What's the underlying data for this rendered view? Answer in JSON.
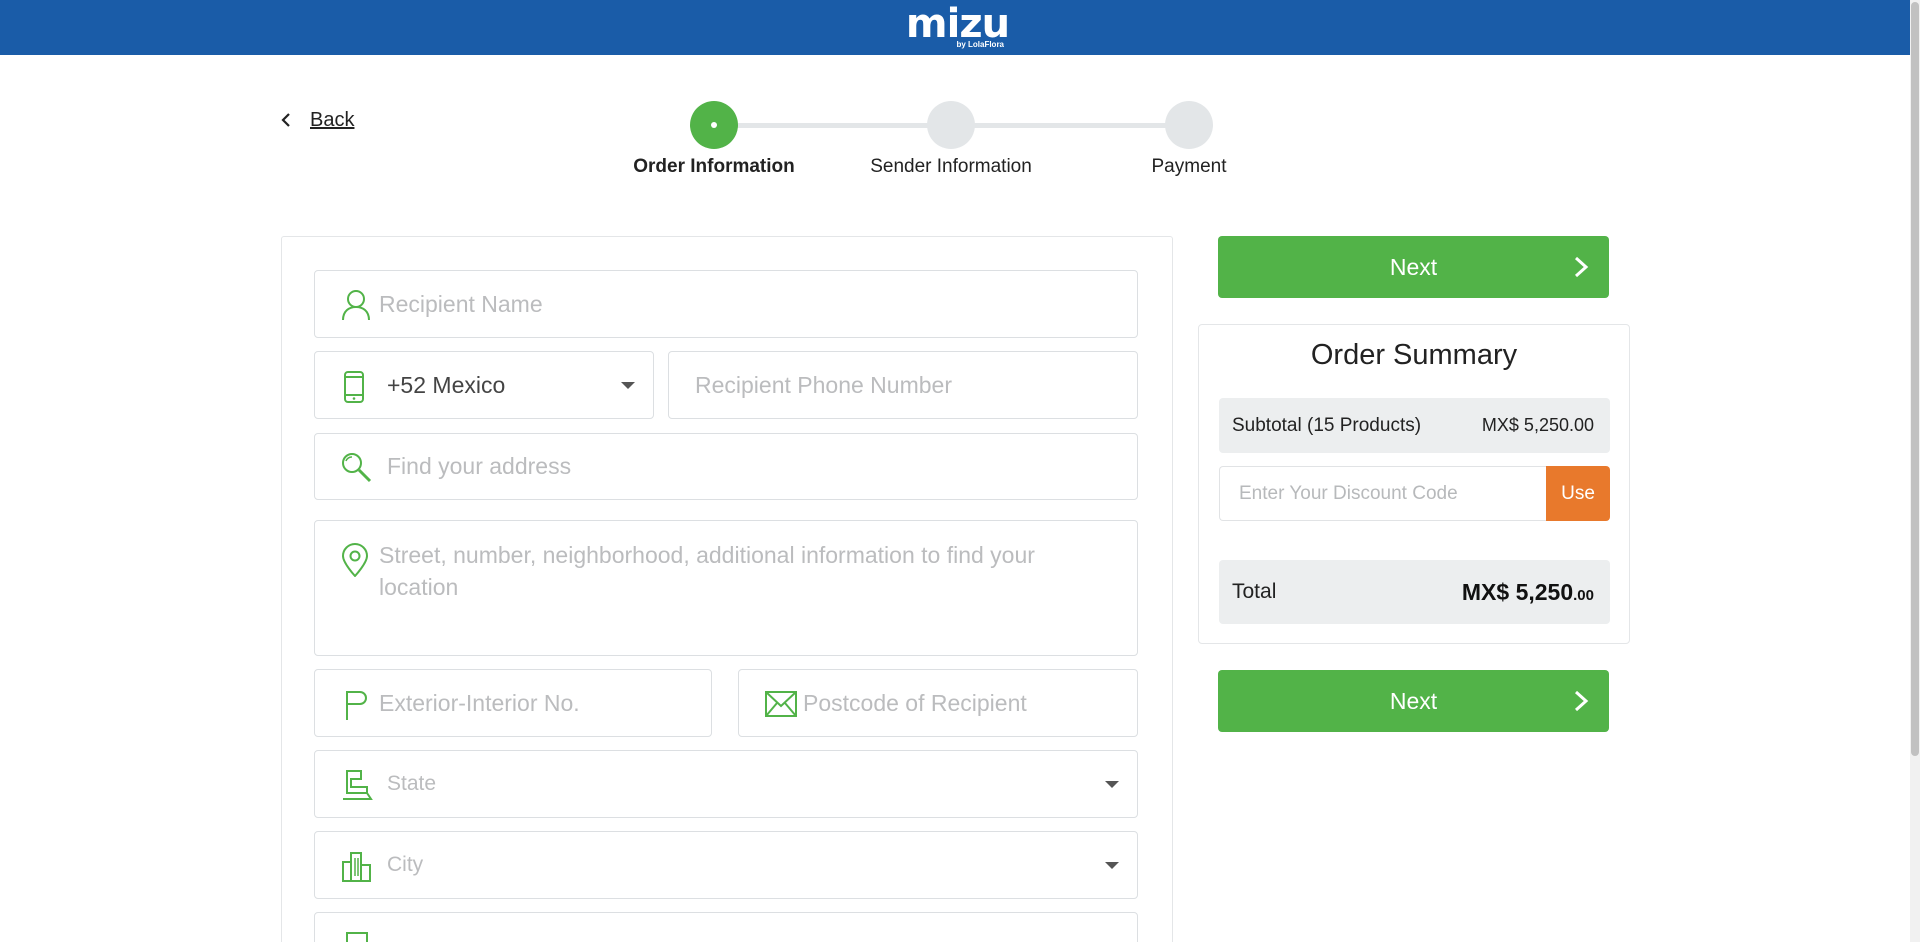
{
  "header": {
    "logo_text": "mizu",
    "logo_sub": "by LolaFlora",
    "brand_color": "#1a5ca8"
  },
  "nav": {
    "back_label": "Back"
  },
  "steps": [
    {
      "label": "Order Information",
      "state": "active"
    },
    {
      "label": "Sender Information",
      "state": "pending"
    },
    {
      "label": "Payment",
      "state": "pending"
    }
  ],
  "form": {
    "recipient_name": {
      "placeholder": "Recipient Name",
      "icon": "person-icon"
    },
    "country_code": {
      "value": "+52 Mexico",
      "icon": "phone-icon"
    },
    "recipient_phone": {
      "placeholder": "Recipient Phone Number"
    },
    "address_search": {
      "placeholder": "Find your address",
      "icon": "search-icon"
    },
    "address_details": {
      "placeholder": "Street, number, neighborhood, additional information to find your location",
      "icon": "location-pin-icon"
    },
    "ext_int_no": {
      "placeholder": "Exterior-Interior No.",
      "icon": "flag-icon"
    },
    "postcode": {
      "placeholder": "Postcode of Recipient",
      "icon": "envelope-icon"
    },
    "state": {
      "placeholder": "State",
      "icon": "state-icon"
    },
    "city": {
      "placeholder": "City",
      "icon": "city-icon"
    }
  },
  "actions": {
    "next_label": "Next",
    "accent_color": "#52b348"
  },
  "summary": {
    "title": "Order Summary",
    "subtotal_label": "Subtotal (15 Products)",
    "subtotal_value": "MX$ 5,250.00",
    "discount_placeholder": "Enter Your Discount Code",
    "use_label": "Use",
    "use_color": "#e8792c",
    "total_label": "Total",
    "total_main": "MX$ 5,250",
    "total_cents": ".00"
  }
}
